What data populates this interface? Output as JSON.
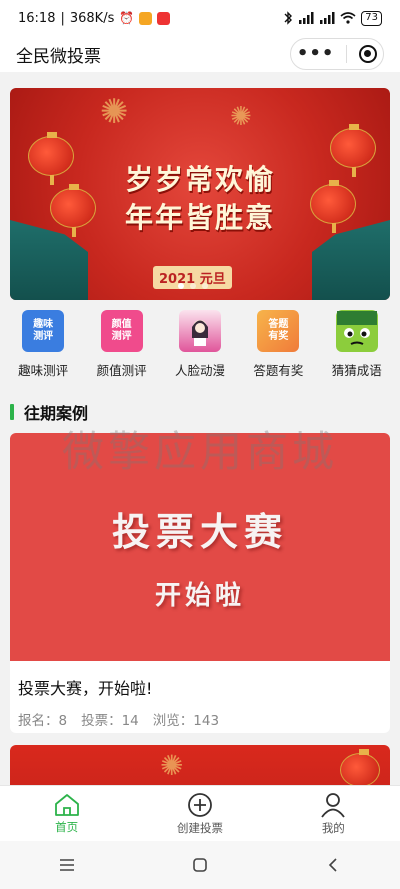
{
  "status_bar": {
    "time": "16:18",
    "network_speed": "368K/s",
    "battery": "73",
    "icons": [
      "bluetooth-icon",
      "signal-icon",
      "wifi-icon",
      "alarm-icon",
      "notification-icon"
    ]
  },
  "title_bar": {
    "title": "全民微投票",
    "more_icon": "more-dots-icon",
    "close_icon": "target-icon"
  },
  "banner": {
    "line1": "岁岁常欢愉",
    "line2": "年年皆胜意",
    "date_tag": "2021 元旦",
    "slide_count": 3,
    "active_slide": 0
  },
  "categories": [
    {
      "label": "趣味测评",
      "icon_text": "趣味\n测评",
      "color": "#3a7de0"
    },
    {
      "label": "颜值测评",
      "icon_text": "颜值\n测评",
      "color": "#f04b8c"
    },
    {
      "label": "人脸动漫",
      "icon_text": "人脸\n动漫",
      "color": "#e0559a"
    },
    {
      "label": "答题有奖",
      "icon_text": "答题\n有奖",
      "color": "#f5a13a"
    },
    {
      "label": "猜猜成语",
      "icon_text": "成语",
      "color": "#6fbf3a"
    }
  ],
  "section": {
    "title": "往期案例"
  },
  "watermark": "微擎应用商城",
  "cases": [
    {
      "image_line1": "投票大赛",
      "image_line2": "开始啦",
      "title": "投票大赛，开始啦!",
      "stats": {
        "signup_label": "报名：",
        "signup_value": "8",
        "votes_label": "投票：",
        "votes_value": "14",
        "views_label": "浏览：",
        "views_value": "143"
      }
    }
  ],
  "tab_bar": {
    "tabs": [
      {
        "label": "首页",
        "icon": "home-icon",
        "active": true
      },
      {
        "label": "创建投票",
        "icon": "plus-circle-icon",
        "active": false
      },
      {
        "label": "我的",
        "icon": "user-icon",
        "active": false
      }
    ]
  },
  "colors": {
    "accent": "#2cb34a",
    "banner_red": "#c8281f",
    "case_red": "#e24a46"
  }
}
